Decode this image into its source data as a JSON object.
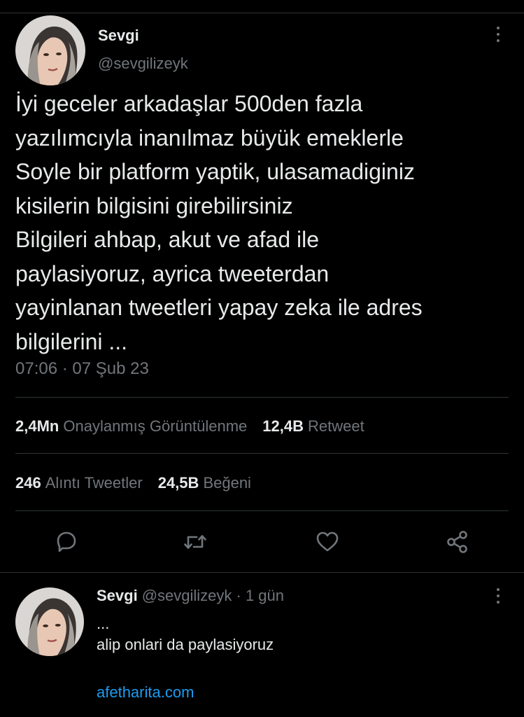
{
  "tweet": {
    "display_name": "Sevgi",
    "handle": "@sevgilizeyk",
    "text_lines": [
      "İyi geceler arkadaşlar 500den fazla",
      "yazılımcıyla inanılmaz büyük emeklerle",
      "Soyle bir platform yaptik, ulasamadiginiz",
      "kisilerin bilgisini girebilirsiniz",
      "Bilgileri ahbap, akut ve afad ile",
      "paylasiyoruz, ayrica tweeterdan",
      "yayinlanan tweetleri yapay zeka ile adres",
      "bilgilerini ..."
    ],
    "timestamp": "07:06 · 07 Şub 23"
  },
  "stats": {
    "views_count": "2,4Mn",
    "views_label": "Onaylanmış Görüntülenme",
    "retweets_count": "12,4B",
    "retweets_label": "Retweet",
    "quotes_count": "246",
    "quotes_label": "Alıntı Tweetler",
    "likes_count": "24,5B",
    "likes_label": "Beğeni"
  },
  "actions": [
    "reply-icon",
    "retweet-icon",
    "like-icon",
    "share-icon"
  ],
  "reply": {
    "display_name": "Sevgi",
    "handle_time": "@sevgilizeyk · 1 gün",
    "line1": "...",
    "line2": "alip onlari da paylasiyoruz",
    "link": "afetharita.com"
  },
  "colors": {
    "background": "#000000",
    "text": "#e7e9ea",
    "muted": "#71767b",
    "link": "#1d9bf0",
    "divider": "#2f3336"
  }
}
